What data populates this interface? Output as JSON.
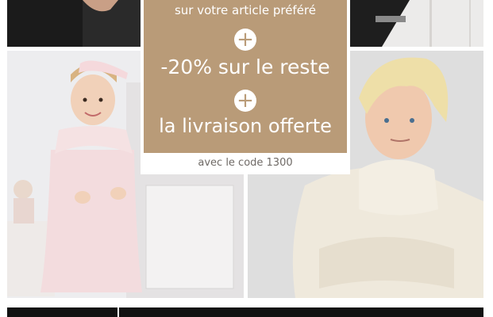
{
  "promo": {
    "line1": "sur votre article préféré",
    "plus": "+",
    "line2": "-20% sur le reste",
    "line3": "la livraison offerte",
    "code_text": "avec le code 1300"
  },
  "colors": {
    "promo_bg": "#b99b78",
    "code_text": "#6f6a66"
  }
}
